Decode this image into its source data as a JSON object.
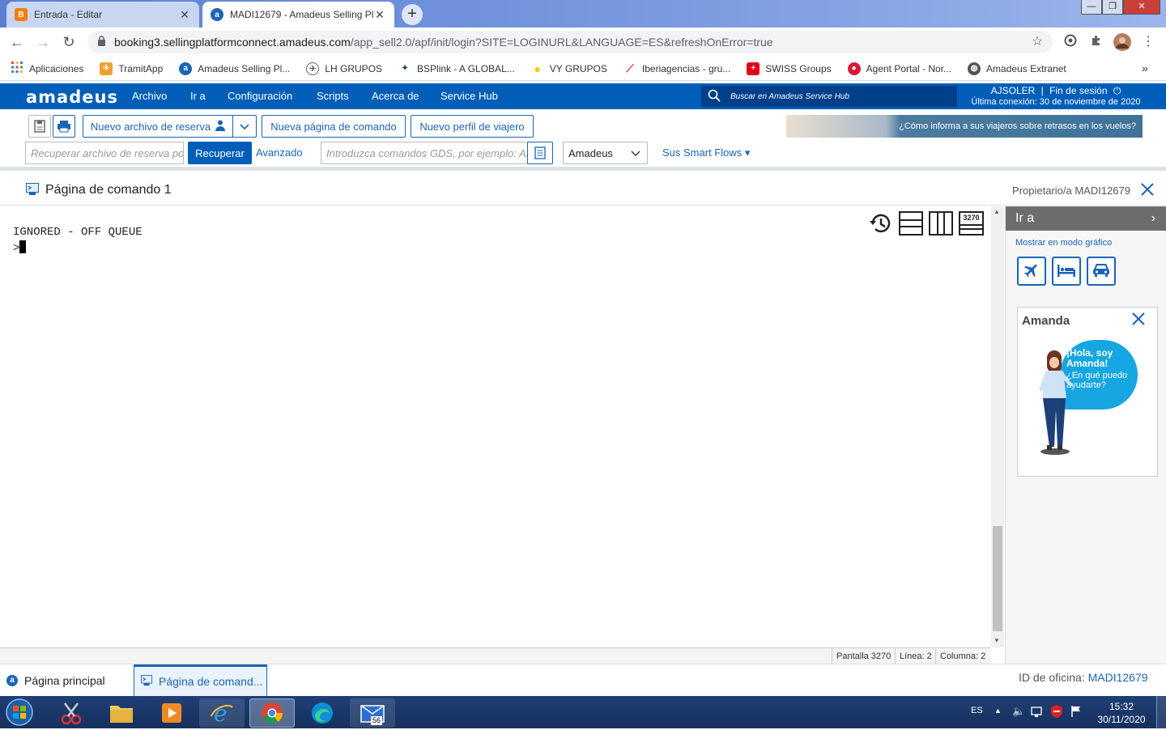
{
  "browser": {
    "tabs": [
      {
        "label": "Entrada - Editar",
        "close": "✕"
      },
      {
        "label": "MADI12679 - Amadeus Selling Pl",
        "close": "✕"
      }
    ],
    "new_tab": "+",
    "url_host": "booking3.sellingplatformconnect.amadeus.com",
    "url_path": "/app_sell2.0/apf/init/login?SITE=LOGINURL&LANGUAGE=ES&refreshOnError=true",
    "bookmarks": [
      {
        "label": "Aplicaciones",
        "icon": "apps-grid-icon",
        "color": "#e8453c"
      },
      {
        "label": "TramitApp",
        "icon": "tramitapp-icon",
        "color": "#f0a030"
      },
      {
        "label": "Amadeus Selling Pl...",
        "icon": "amadeus-icon",
        "color": "#1a64b6"
      },
      {
        "label": "LH GRUPOS",
        "icon": "lufthansa-icon",
        "color": "#666666"
      },
      {
        "label": "BSPlink - A GLOBAL...",
        "icon": "bsplink-icon",
        "color": "#1d3f7a"
      },
      {
        "label": "VY GRUPOS",
        "icon": "vueling-icon",
        "color": "#f5c800"
      },
      {
        "label": "Iberiagencias - gru...",
        "icon": "iberia-icon",
        "color": "#d61f26"
      },
      {
        "label": "SWISS Groups",
        "icon": "swiss-icon",
        "color": "#e2001a"
      },
      {
        "label": "Agent Portal - Nor...",
        "icon": "norwegian-icon",
        "color": "#d81939"
      },
      {
        "label": "Amadeus Extranet",
        "icon": "globe-icon",
        "color": "#555555"
      }
    ],
    "more": "»"
  },
  "header": {
    "logo": "amadeus",
    "menu": [
      "Archivo",
      "Ir a",
      "Configuración",
      "Scripts",
      "Acerca de",
      "Service Hub"
    ],
    "search_placeholder": "Buscar en Amadeus Service Hub",
    "user": "AJSOLER",
    "logout": "Fin de sesión",
    "last_login": "Última conexión: 30 de noviembre de 2020"
  },
  "actions": {
    "new_reservation": "Nuevo archivo de reserva",
    "new_command_page": "Nueva página de comando",
    "new_traveler_profile": "Nuevo perfil de viajero",
    "recover_placeholder": "Recuperar archivo de reserva po...",
    "recover_button": "Recuperar",
    "advanced": "Avanzado",
    "gds_placeholder": "Introduzca comandos GDS, por ejemplo: AN",
    "gds_select": "Amadeus",
    "smart_flows": "Sus Smart Flows ▾",
    "banner": "¿Cómo informa a sus viajeros sobre retrasos en los vuelos?"
  },
  "page": {
    "title": "Página de comando 1",
    "owner": "Propietario/a MADI12679",
    "output_line": "IGNORED - OFF QUEUE",
    "prompt": ">",
    "mode_3270": "3270"
  },
  "status": {
    "screen": "Pantalla 3270",
    "line": "Línea: 2",
    "column": "Columna: 2"
  },
  "right_panel": {
    "title": "Ir a",
    "graphic_mode": "Mostrar en modo gráfico",
    "amanda_title": "Amanda",
    "amanda_hello": "¡Hola, soy Amanda!",
    "amanda_help": "¿En qué puedo ayudarte?"
  },
  "bottom": {
    "tab_home": "Página principal",
    "tab_command": "Página de comand...",
    "office_label": "ID de oficina:",
    "office_id": "MADI12679"
  },
  "taskbar": {
    "lang": "ES",
    "time": "15:32",
    "date": "30/11/2020",
    "mail_badge": "56"
  },
  "colors": {
    "amadeus_blue": "#005eb8",
    "link_blue": "#1a64b6"
  }
}
